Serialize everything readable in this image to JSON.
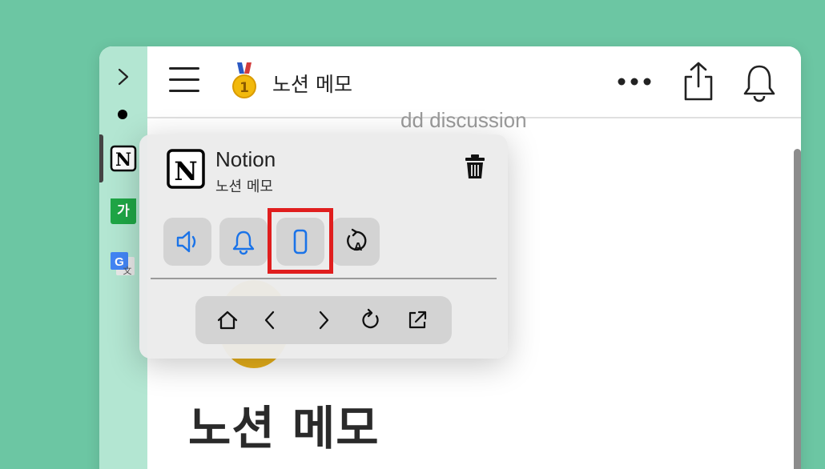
{
  "header": {
    "page_title": "노션 메모"
  },
  "main": {
    "discussion_text": "dd discussion",
    "big_title": "노션 메모"
  },
  "sidebar": {
    "items": [
      {
        "icon": "chevron-right-icon"
      },
      {
        "icon": "dot-icon"
      },
      {
        "icon": "notion-icon"
      },
      {
        "icon": "naver-dictionary-icon",
        "label": "가"
      },
      {
        "icon": "google-translate-icon",
        "label": "文"
      }
    ]
  },
  "popup": {
    "app_name": "Notion",
    "subtitle": "노션 메모",
    "actions": [
      "speaker-icon",
      "bell-icon",
      "mobile-view-icon",
      "translate-icon"
    ],
    "nav": [
      "home-icon",
      "back-icon",
      "forward-icon",
      "reload-icon",
      "open-external-icon"
    ]
  },
  "colors": {
    "background": "#6cc6a3",
    "sidebar": "#b3e6d2",
    "accent_blue": "#1a73e8",
    "highlight_red": "#e01e1e"
  }
}
